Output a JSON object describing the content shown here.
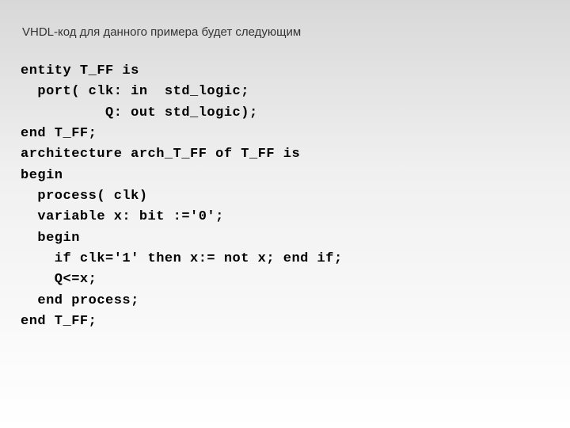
{
  "title": "VHDL-код для данного примера будет следующим",
  "code": {
    "l1": "entity T_FF is",
    "l2": "  port( clk: in  std_logic;",
    "l3": "          Q: out std_logic);",
    "l4": "end T_FF;",
    "l5": "architecture arch_T_FF of T_FF is",
    "l6": "begin",
    "l7": "  process( clk)",
    "l8": "  variable x: bit :='0';",
    "l9": "  begin",
    "l10": "    if clk='1' then x:= not x; end if;",
    "l11": "    Q<=x;",
    "l12": "  end process;",
    "l13": "end T_FF;"
  }
}
